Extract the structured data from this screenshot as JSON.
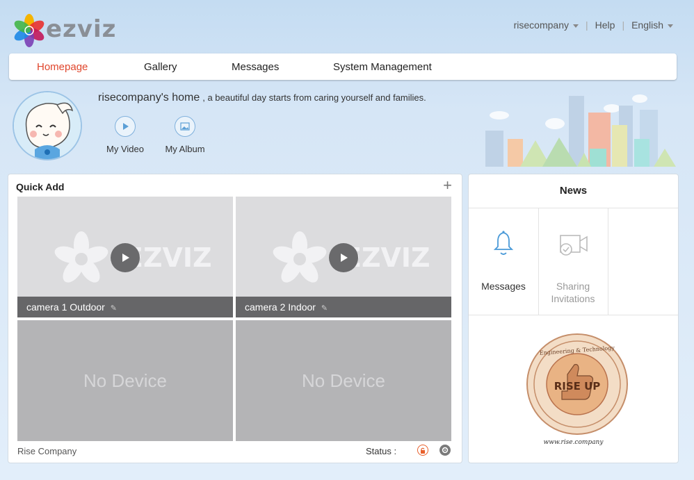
{
  "brand": {
    "logo_text": "ezviz"
  },
  "top_bar": {
    "user": "risecompany",
    "help": "Help",
    "language": "English"
  },
  "nav": {
    "items": [
      {
        "label": "Homepage",
        "active": true
      },
      {
        "label": "Gallery",
        "active": false
      },
      {
        "label": "Messages",
        "active": false
      },
      {
        "label": "System Management",
        "active": false
      }
    ]
  },
  "profile": {
    "title": "risecompany's home",
    "subtitle": ", a beautiful day starts from caring yourself and families.",
    "shortcuts": [
      {
        "label": "My Video",
        "icon": "play-circle-icon"
      },
      {
        "label": "My Album",
        "icon": "image-icon"
      }
    ]
  },
  "quick_add": {
    "title": "Quick Add",
    "plus": "+",
    "cameras": [
      {
        "name": "camera 1 Outdoor",
        "watermark": "EZVIZ"
      },
      {
        "name": "camera 2 Indoor",
        "watermark": "EZVIZ"
      }
    ],
    "empty_slots": [
      {
        "label": "No Device"
      },
      {
        "label": "No Device"
      }
    ],
    "footer": {
      "group_name": "Rise Company",
      "status_label": "Status :"
    }
  },
  "news": {
    "title": "News",
    "items": [
      {
        "label": "Messages",
        "icon": "bell-icon",
        "enabled": true
      },
      {
        "label": "Sharing Invitations",
        "icon": "share-camera-icon",
        "enabled": false
      }
    ],
    "ad": {
      "top_text": "Engineering & Technology",
      "badge_text": "RISE UP",
      "url": "www.rise.company"
    }
  },
  "colors": {
    "accent": "#e0462c",
    "nav_bg": "#ffffff",
    "camera_bar": "#666668",
    "no_device_bg": "#b4b4b6"
  }
}
